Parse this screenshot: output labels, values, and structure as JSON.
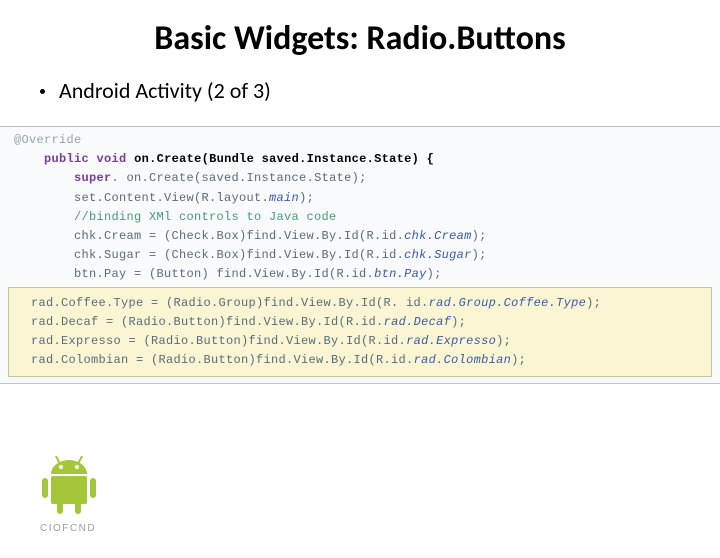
{
  "title": "Basic Widgets: Radio.Buttons",
  "subtitle": "Android Activity (2 of 3)",
  "code": {
    "annotation": "@Override",
    "line1_a": "public",
    "line1_b": "void",
    "line1_c": "on.Create(Bundle saved.Instance.State) {",
    "line2_a": "super",
    "line2_b": ". on.Create(saved.Instance.State);",
    "line3_a": "set.Content.View(R.layout.",
    "line3_b": "main",
    "line3_c": ");",
    "line4": "//binding XMl controls to Java code",
    "line5_a": "chk.Cream = (Check.Box)find.View.By.Id(R.id.",
    "line5_b": "chk.Cream",
    "line5_c": ");",
    "line6_a": "chk.Sugar = (Check.Box)find.View.By.Id(R.id.",
    "line6_b": "chk.Sugar",
    "line6_c": ");",
    "line7_a": "btn.Pay = (Button) find.View.By.Id(R.id.",
    "line7_b": "btn.Pay",
    "line7_c": ");"
  },
  "highlighted": {
    "h1_a": "rad.Coffee.Type = (Radio.Group)find.View.By.Id(R. id.",
    "h1_b": "rad.Group.Coffee.Type",
    "h1_c": ");",
    "h2_a": "rad.Decaf = (Radio.Button)find.View.By.Id(R.id.",
    "h2_b": "rad.Decaf",
    "h2_c": ");",
    "h3_a": "rad.Expresso = (Radio.Button)find.View.By.Id(R.id.",
    "h3_b": "rad.Expresso",
    "h3_c": ");",
    "h4_a": "rad.Colombian = (Radio.Button)find.View.By.Id(R.id.",
    "h4_b": "rad.Colombian",
    "h4_c": ");"
  },
  "logo_wordmark": "CIOFCND"
}
